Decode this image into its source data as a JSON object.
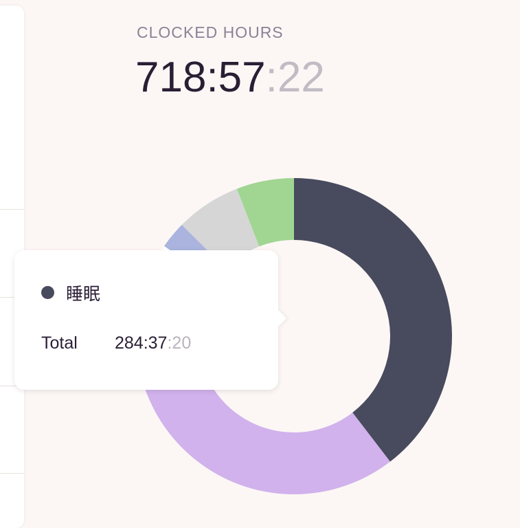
{
  "clocked": {
    "label": "CLOCKED HOURS",
    "main": "718:57",
    "seconds": ":22"
  },
  "tooltip": {
    "name": "睡眠",
    "total_label": "Total",
    "total_main": "284:37",
    "total_seconds": ":20",
    "dot_color": "#484a5e"
  },
  "chart_data": {
    "type": "pie",
    "donut": true,
    "title": "",
    "slices": [
      {
        "name": "睡眠",
        "value": 284.62,
        "color": "#484a5e"
      },
      {
        "name": "",
        "value": 240.0,
        "color": "#d1b2ec"
      },
      {
        "name": "",
        "value": 84.0,
        "color": "#ffffff"
      },
      {
        "name": "",
        "value": 20.0,
        "color": "#aab4de"
      },
      {
        "name": "",
        "value": 48.0,
        "color": "#d6d6d6"
      },
      {
        "name": "",
        "value": 42.35,
        "color": "#a0d592"
      }
    ]
  }
}
